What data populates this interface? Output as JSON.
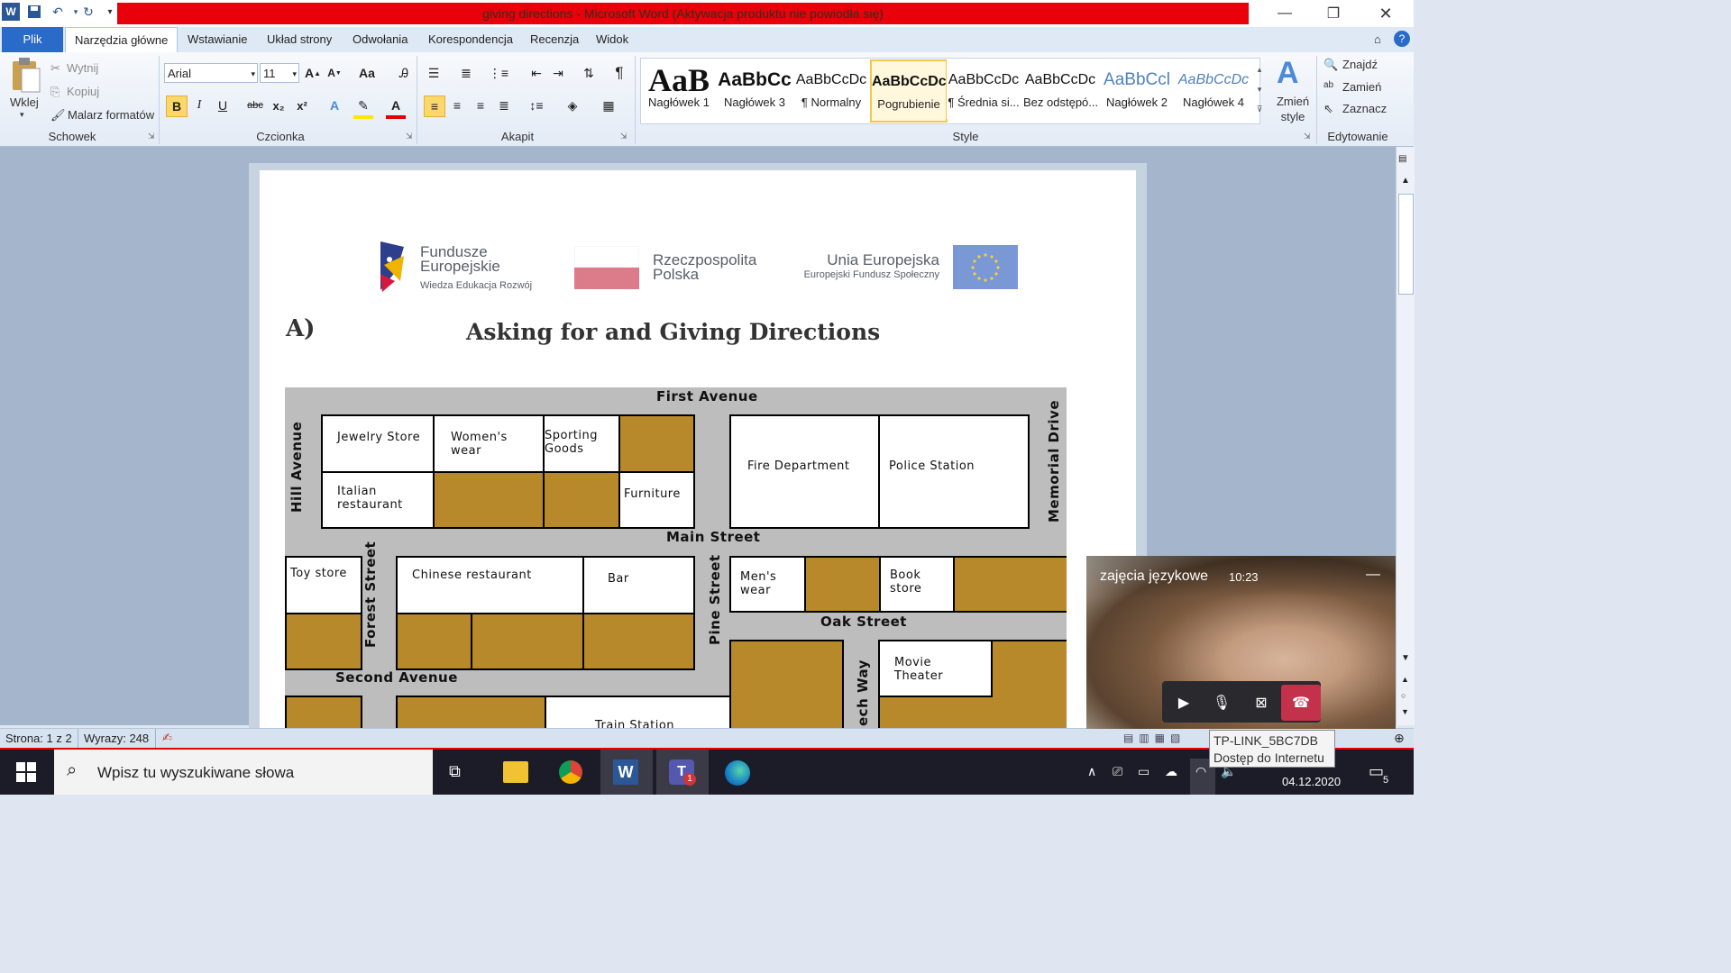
{
  "window": {
    "title": "giving directions - Microsoft Word (Aktywacja produktu nie powiodła się)",
    "accent": "#e8000b"
  },
  "tabs": [
    "Plik",
    "Narzędzia główne",
    "Wstawianie",
    "Układ strony",
    "Odwołania",
    "Korespondencja",
    "Recenzja",
    "Widok"
  ],
  "ribbon": {
    "clipboard": {
      "paste": "Wklej",
      "cut": "Wytnij",
      "copy": "Kopiuj",
      "painter": "Malarz formatów",
      "label": "Schowek"
    },
    "font": {
      "name": "Arial",
      "size": "11",
      "label": "Czcionka"
    },
    "paragraph": {
      "label": "Akapit"
    },
    "styles": {
      "label": "Style",
      "items": [
        {
          "preview": "AaB",
          "name": "Nagłówek 1"
        },
        {
          "preview": "AaBbCc",
          "name": "Nagłówek 3"
        },
        {
          "preview": "AaBbCcDc",
          "name": "¶ Normalny"
        },
        {
          "preview": "AaBbCcDc",
          "name": "Pogrubienie"
        },
        {
          "preview": "AaBbCcDc",
          "name": "¶ Średnia si..."
        },
        {
          "preview": "AaBbCcDc",
          "name": "Bez odstępó..."
        },
        {
          "preview": "AaBbCcl",
          "name": "Nagłówek 2"
        },
        {
          "preview": "AaBbCcDc",
          "name": "Nagłówek 4"
        }
      ],
      "change": "Zmień style"
    },
    "editing": {
      "find": "Znajdź",
      "replace": "Zamień",
      "select": "Zaznacz",
      "label": "Edytowanie"
    }
  },
  "document": {
    "logos": {
      "fe_line1": "Fundusze",
      "fe_line2": "Europejskie",
      "fe_sub": "Wiedza Edukacja Rozwój",
      "rp_line1": "Rzeczpospolita",
      "rp_line2": "Polska",
      "ue_line1": "Unia Europejska",
      "ue_sub": "Europejski Fundusz Społeczny"
    },
    "section_letter": "A)",
    "heading": "Asking for and Giving Directions",
    "map": {
      "streets": {
        "first_avenue": "First Avenue",
        "main_street": "Main Street",
        "hill_avenue": "Hill Avenue",
        "memorial_drive": "Memorial Drive",
        "forest_street": "Forest Street",
        "pine_street": "Pine Street",
        "oak_street": "Oak Street",
        "second_avenue": "Second Avenue",
        "beech_way": "ech Way"
      },
      "places": {
        "jewelry": "Jewelry Store",
        "womens_wear": "Women's wear",
        "sporting_goods": "Sporting Goods",
        "italian": "Italian restaurant",
        "furniture": "Furniture",
        "fire_dept": "Fire Department",
        "police": "Police Station",
        "toy_store": "Toy store",
        "chinese": "Chinese restaurant",
        "bar": "Bar",
        "mens_wear": "Men's wear",
        "book_store": "Book store",
        "movie": "Movie Theater",
        "train": "Train Station"
      }
    }
  },
  "status": {
    "page": "Strona: 1 z 2",
    "words": "Wyrazy: 248"
  },
  "video": {
    "title": "zajęcia językowe",
    "time": "10:23"
  },
  "tooltip": {
    "line1": "TP-LINK_5BC7DB",
    "line2": "Dostęp do Internetu"
  },
  "taskbar": {
    "search_placeholder": "Wpisz tu wyszukiwane słowa",
    "date": "04.12.2020",
    "teams_badge": "1",
    "notif_count": "5"
  }
}
